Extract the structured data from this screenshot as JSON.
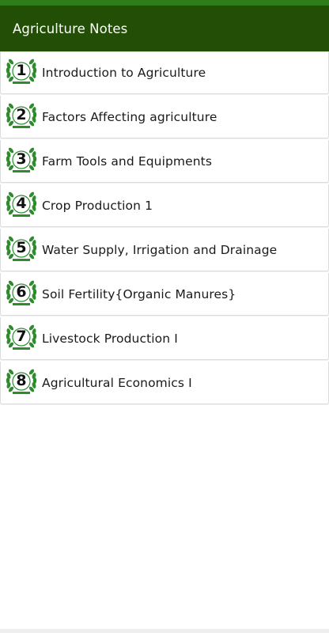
{
  "colors": {
    "status_bar": "#2f7d1a",
    "toolbar": "#234e06",
    "toolbar_text": "#ffffff",
    "laurel": "#2e8b2e"
  },
  "toolbar": {
    "title": "Agriculture Notes"
  },
  "topics": [
    {
      "number": "1",
      "label": "Introduction to Agriculture",
      "icon": "laurel-wreath-icon"
    },
    {
      "number": "2",
      "label": "Factors Affecting agriculture",
      "icon": "laurel-wreath-icon"
    },
    {
      "number": "3",
      "label": "Farm Tools and Equipments",
      "icon": "laurel-wreath-icon"
    },
    {
      "number": "4",
      "label": "Crop Production 1",
      "icon": "laurel-wreath-icon"
    },
    {
      "number": "5",
      "label": "Water Supply, Irrigation and Drainage",
      "icon": "laurel-wreath-icon"
    },
    {
      "number": "6",
      "label": "Soil Fertility{Organic Manures}",
      "icon": "laurel-wreath-icon"
    },
    {
      "number": "7",
      "label": "Livestock Production I",
      "icon": "laurel-wreath-icon"
    },
    {
      "number": "8",
      "label": "Agricultural Economics I",
      "icon": "laurel-wreath-icon"
    }
  ]
}
